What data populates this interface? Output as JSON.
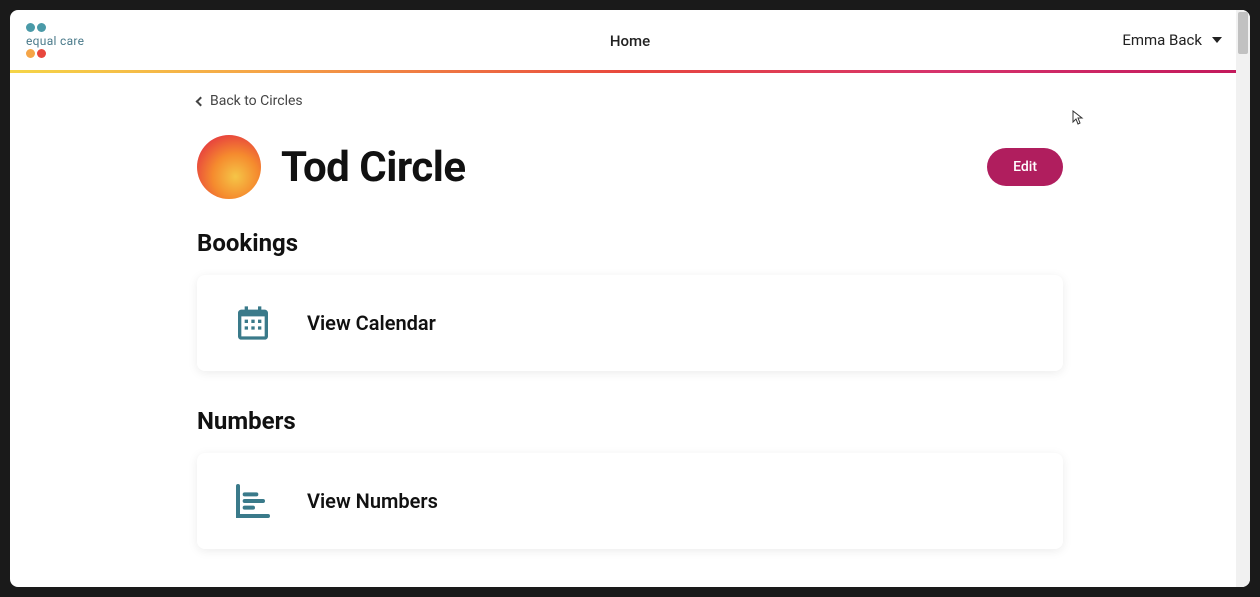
{
  "brand": {
    "name": "equal care",
    "dot_colors_top": [
      "#4a9aa8",
      "#4a9aa8"
    ],
    "dot_colors_bottom": [
      "#f5a547",
      "#e8473d"
    ]
  },
  "nav": {
    "home": "Home"
  },
  "user": {
    "name": "Emma Back"
  },
  "back": {
    "label": "Back to Circles"
  },
  "circle": {
    "title": "Tod Circle",
    "edit_label": "Edit"
  },
  "sections": {
    "bookings": {
      "title": "Bookings",
      "card_label": "View Calendar"
    },
    "numbers": {
      "title": "Numbers",
      "card_label": "View Numbers"
    }
  },
  "colors": {
    "accent_button": "#b01e5e",
    "icon_teal": "#3a7a8a"
  }
}
